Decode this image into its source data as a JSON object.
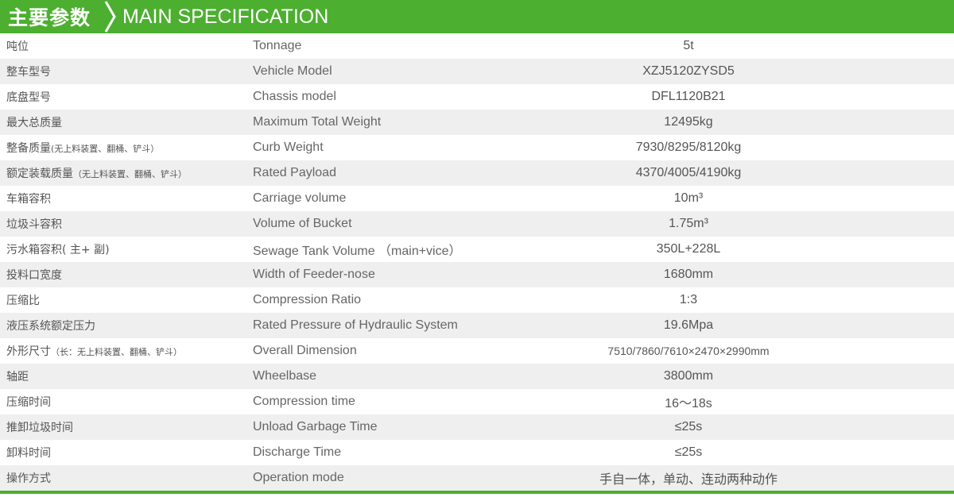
{
  "header": {
    "title_cn": "主要参数",
    "title_en": "MAIN SPECIFICATION",
    "accent_color": "#4caf30"
  },
  "rows": [
    {
      "cn": "吨位",
      "cn_note": "",
      "en": "Tonnage",
      "value": "5t"
    },
    {
      "cn": "整车型号",
      "cn_note": "",
      "en": "Vehicle Model",
      "value": "XZJ5120ZYSD5"
    },
    {
      "cn": "底盘型号",
      "cn_note": "",
      "en": "Chassis model",
      "value": "DFL1120B21"
    },
    {
      "cn": "最大总质量",
      "cn_note": "",
      "en": "Maximum Total Weight",
      "value": "12495kg"
    },
    {
      "cn": "整备质量",
      "cn_note": "(无上料装置、翻桶、铲斗）",
      "en": "Curb Weight",
      "value": "7930/8295/8120kg"
    },
    {
      "cn": "额定装载质量",
      "cn_note": "（无上料装置、翻桶、铲斗）",
      "en": "Rated Payload",
      "value": "4370/4005/4190kg"
    },
    {
      "cn": "车箱容积",
      "cn_note": "",
      "en": "Carriage volume",
      "value": "10m³"
    },
    {
      "cn": "垃圾斗容积",
      "cn_note": "",
      "en": "Volume of  Bucket",
      "value": "1.75m³"
    },
    {
      "cn": "污水箱容积( 主+ 副)",
      "cn_note": "",
      "en": "Sewage Tank Volume （main+vice）",
      "value": "350L+228L"
    },
    {
      "cn": "投料口宽度",
      "cn_note": "",
      "en": "Width of  Feeder-nose",
      "value": "1680mm"
    },
    {
      "cn": "压缩比",
      "cn_note": "",
      "en": "Compression Ratio",
      "value": "1:3"
    },
    {
      "cn": "液压系统额定压力",
      "cn_note": "",
      "en": "Rated Pressure of Hydraulic System",
      "value": "19.6Mpa"
    },
    {
      "cn": "外形尺寸",
      "cn_note": "（长：无上料装置、翻桶、铲斗）",
      "en": "Overall Dimension",
      "value": "7510/7860/7610×2470×2990mm"
    },
    {
      "cn": "轴距",
      "cn_note": "",
      "en": "Wheelbase",
      "value": "3800mm"
    },
    {
      "cn": "压缩时间",
      "cn_note": "",
      "en": "Compression time",
      "value": "16～18s"
    },
    {
      "cn": "推卸垃圾时间",
      "cn_note": "",
      "en": "Unload Garbage Time",
      "value": "≤25s"
    },
    {
      "cn": "卸料时间",
      "cn_note": "",
      "en": "Discharge Time",
      "value": "≤25s"
    },
    {
      "cn": "操作方式",
      "cn_note": "",
      "en": "Operation mode",
      "value": "手自一体，单动、连动两种动作"
    }
  ]
}
